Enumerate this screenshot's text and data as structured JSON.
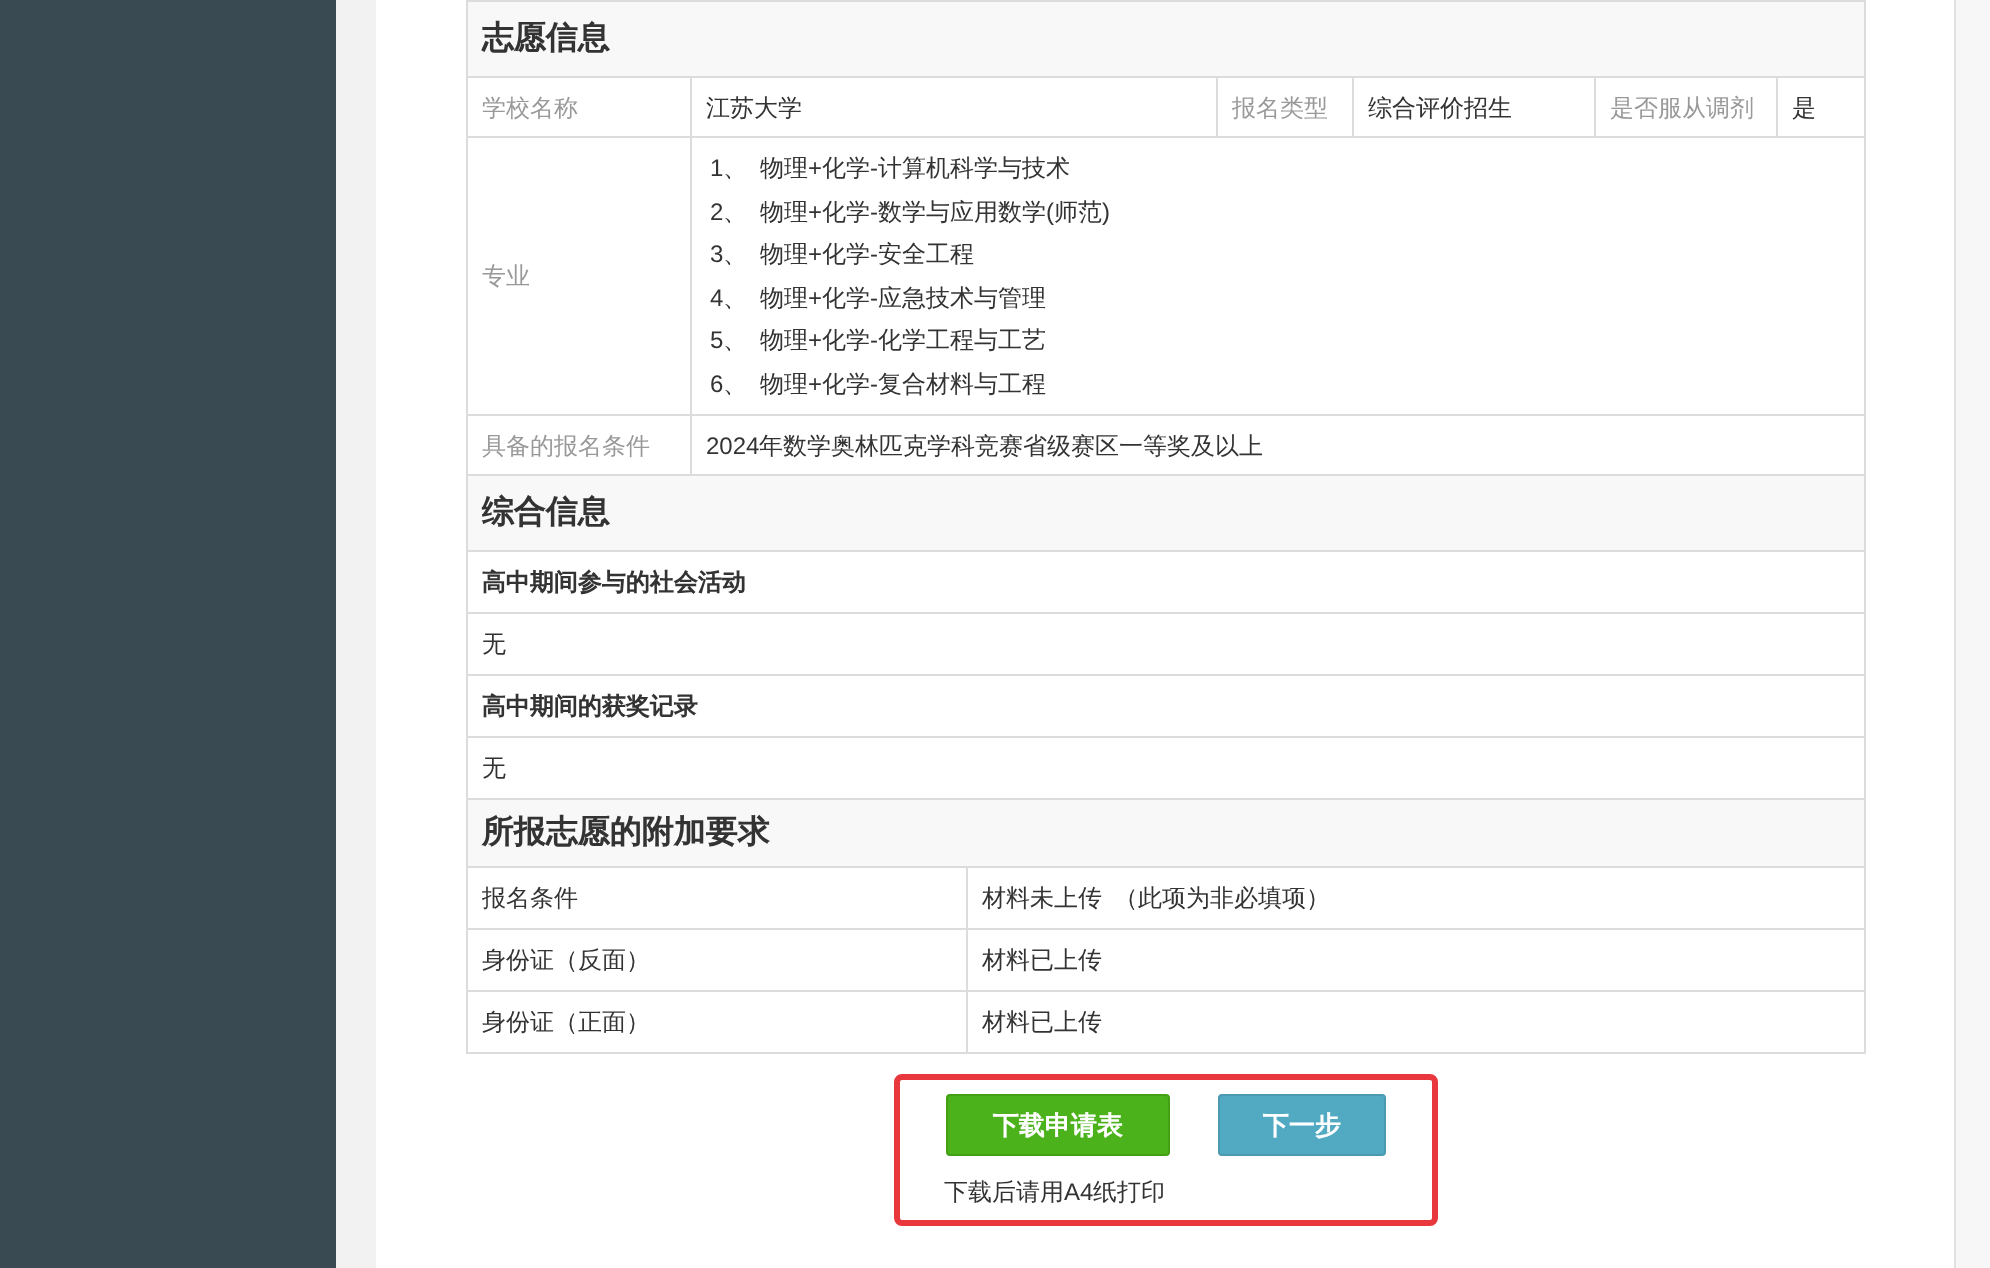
{
  "wish": {
    "title": "志愿信息",
    "school_row": [
      {
        "label": "学校名称",
        "value": "江苏大学"
      },
      {
        "label": "报名类型",
        "value": "综合评价招生"
      },
      {
        "label": "是否服从调剂",
        "value": "是"
      }
    ],
    "major_label": "专业",
    "majors": [
      {
        "index": "1、",
        "name": "物理+化学-计算机科学与技术"
      },
      {
        "index": "2、",
        "name": "物理+化学-数学与应用数学(师范)"
      },
      {
        "index": "3、",
        "name": "物理+化学-安全工程"
      },
      {
        "index": "4、",
        "name": "物理+化学-应急技术与管理"
      },
      {
        "index": "5、",
        "name": "物理+化学-化学工程与工艺"
      },
      {
        "index": "6、",
        "name": "物理+化学-复合材料与工程"
      }
    ],
    "condition_label": "具备的报名条件",
    "condition": "2024年数学奥林匹克学科竞赛省级赛区一等奖及以上"
  },
  "overall": {
    "title": "综合信息",
    "items": [
      {
        "question": "高中期间参与的社会活动",
        "answer": "无"
      },
      {
        "question": "高中期间的获奖记录",
        "answer": "无"
      }
    ]
  },
  "extra": {
    "title": "所报志愿的附加要求",
    "rows": [
      {
        "label": "报名条件",
        "status": "材料未上传",
        "note": "（此项为非必填项）"
      },
      {
        "label": "身份证（反面）",
        "status": "材料已上传"
      },
      {
        "label": "身份证（正面）",
        "status": "材料已上传"
      }
    ]
  },
  "actions": {
    "buttons": [
      {
        "label": "下载申请表",
        "kind": "primary"
      },
      {
        "label": "下一步",
        "kind": "secondary"
      }
    ],
    "hint": "下载后请用A4纸打印"
  }
}
